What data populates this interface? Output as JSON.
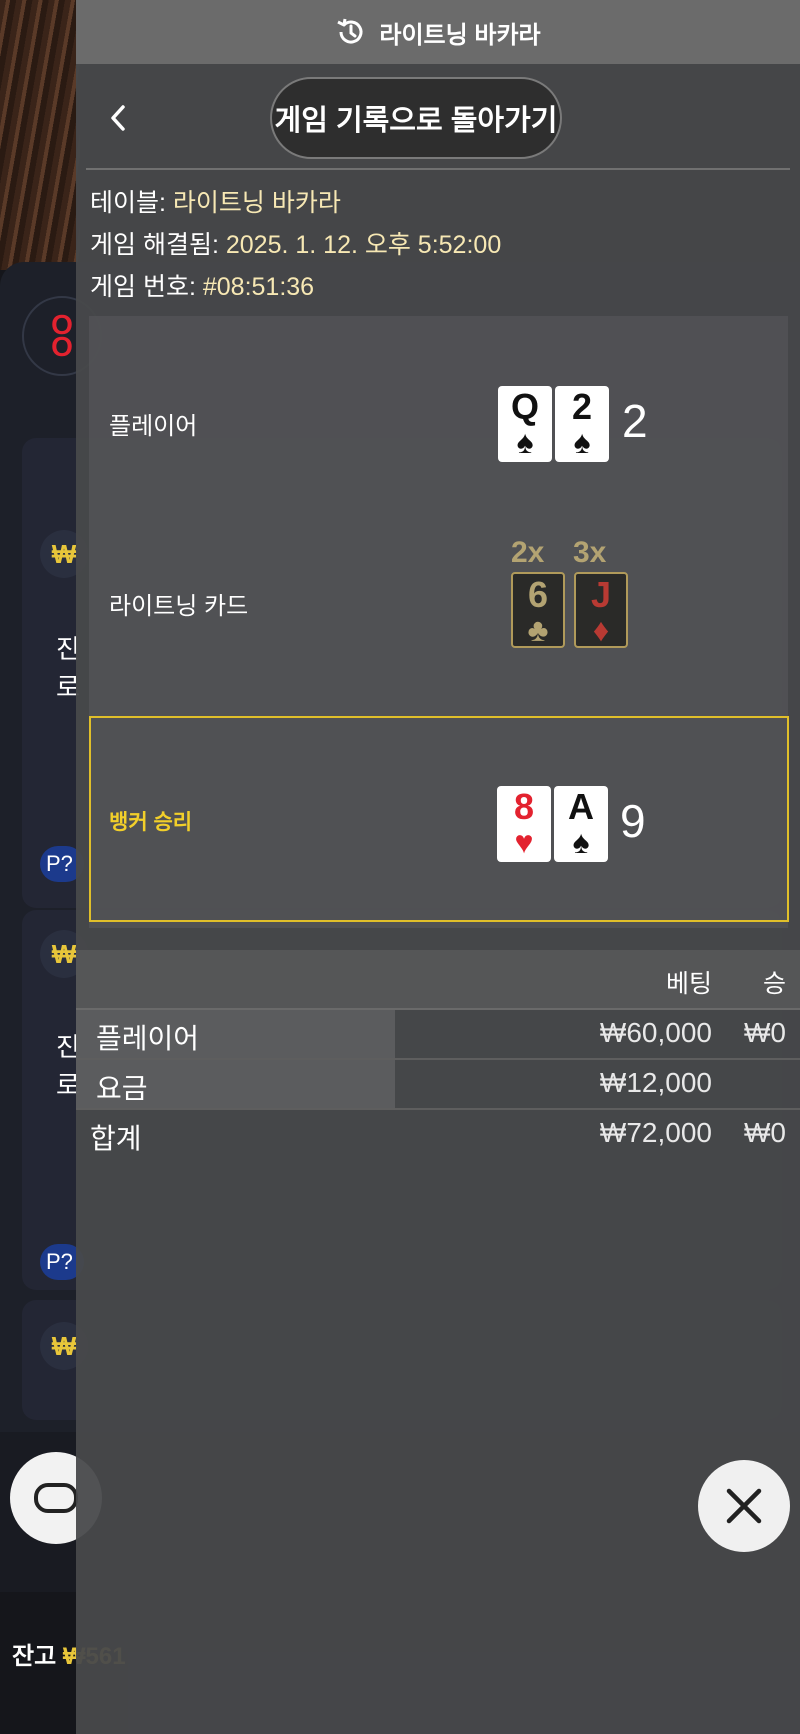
{
  "header": {
    "title": "라이트닝 바카라",
    "icon": "history-icon"
  },
  "nav": {
    "back_label": "게임 기록으로 돌아가기"
  },
  "info": {
    "table_label": "테이블:",
    "table_value": "라이트닝 바카라",
    "resolved_label": "게임 해결됨:",
    "resolved_value": "2025. 1. 12. 오후 5:52:00",
    "game_no_label": "게임 번호:",
    "game_no_value": "#08:51:36"
  },
  "result": {
    "player": {
      "label": "플레이어",
      "cards": [
        {
          "rank": "Q",
          "suit": "♠"
        },
        {
          "rank": "2",
          "suit": "♠"
        }
      ],
      "score": "2"
    },
    "lightning": {
      "label": "라이트닝 카드",
      "cards": [
        {
          "rank": "6",
          "suit": "♣",
          "mult": "2x"
        },
        {
          "rank": "J",
          "suit": "♦",
          "mult": "3x"
        }
      ]
    },
    "banker": {
      "label": "뱅커 승리",
      "cards": [
        {
          "rank": "8",
          "suit": "♥"
        },
        {
          "rank": "A",
          "suit": "♠"
        }
      ],
      "score": "9"
    }
  },
  "bets": {
    "col_bet": "베팅",
    "col_win": "승",
    "rows": [
      {
        "name": "플레이어",
        "amount": "₩60,000",
        "win": "₩0"
      },
      {
        "name": "요금",
        "amount": "₩12,000",
        "win": ""
      }
    ],
    "total": {
      "name": "합계",
      "amount": "₩72,000",
      "win": "₩0"
    }
  },
  "background": {
    "balance_label": "잔고",
    "balance_value": "₩561",
    "row_currency": "₩",
    "chat_icon": "chat-bubble-icon",
    "close_icon": "close-icon"
  },
  "colors": {
    "accent_gold": "#e0bf2a",
    "value_cream": "#f7e8b4",
    "red_suit": "#e3222f"
  }
}
